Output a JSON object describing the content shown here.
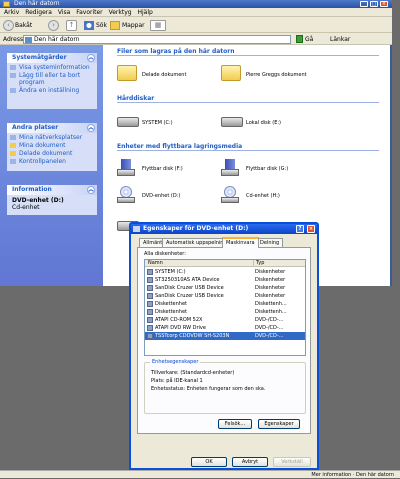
{
  "explorer": {
    "title": "Den här datorn",
    "menu": [
      "Arkiv",
      "Redigera",
      "Visa",
      "Favoriter",
      "Verktyg",
      "Hjälp"
    ],
    "toolbar": {
      "back": "Bakåt",
      "search": "Sök",
      "folders": "Mappar"
    },
    "address_label": "Adress",
    "address_value": "Den här datorn",
    "go_label": "Gå",
    "links_label": "Länkar"
  },
  "tasks": {
    "system": {
      "title": "Systemåtgärder",
      "items": [
        "Visa systeminformation",
        "Lägg till eller ta bort program",
        "Ändra en inställning"
      ]
    },
    "other": {
      "title": "Andra platser",
      "items": [
        "Mina nätverksplatser",
        "Mina dokument",
        "Delade dokument",
        "Kontrollpanelen"
      ]
    },
    "details": {
      "title": "Information",
      "name": "DVD-enhet (D:)",
      "type": "Cd-enhet"
    }
  },
  "main": {
    "section_files": "Filer som lagras på den här datorn",
    "files": [
      "Delade dokument",
      "Pierre Greggs dokument"
    ],
    "section_drives": "Hårddiskar",
    "drives": [
      "SYSTEM (C:)",
      "Lokal disk (E:)"
    ],
    "section_removable": "Enheter med flyttbara lagringsmedia",
    "removable": [
      "Flyttbar disk (F:)",
      "Flyttbar disk (G:)",
      "DVD-enhet (D:)",
      "Cd-enhet (H:)"
    ]
  },
  "status": {
    "text": "Mer information · Den här datorn"
  },
  "dialog": {
    "title": "Egenskaper för DVD-enhet (D:)",
    "tabs": [
      "Allmänt",
      "Automatisk uppspelning",
      "Maskinvara",
      "Delning"
    ],
    "selected_tab": "Maskinvara",
    "list_label": "Alla diskenheter:",
    "columns": [
      "Namn",
      "Typ"
    ],
    "rows": [
      {
        "name": "SYSTEM (C:)",
        "type": "Diskenheter"
      },
      {
        "name": "ST3250310AS ATA Device",
        "type": "Diskenheter"
      },
      {
        "name": "SanDisk Cruzer USB Device",
        "type": "Diskenheter"
      },
      {
        "name": "SanDisk Cruzer USB Device",
        "type": "Diskenheter"
      },
      {
        "name": "Diskettenhet",
        "type": "Diskettenh..."
      },
      {
        "name": "Diskettenhet",
        "type": "Diskettenh..."
      },
      {
        "name": "ATAPI CD-ROM 52X",
        "type": "DVD-/CD-..."
      },
      {
        "name": "ATAPI DVD RW Drive",
        "type": "DVD-/CD-..."
      },
      {
        "name": "TSSTcorp CDDVDW SH-S203N",
        "type": "DVD-/CD-..."
      }
    ],
    "selected_index": 8,
    "props_title": "Enhetsegenskaper",
    "props_lines": [
      "Tillverkare: (Standardcd-enheter)",
      "Plats: på IDE-kanal 1",
      "Enhetsstatus: Enheten fungerar som den ska."
    ],
    "btn_troubleshoot": "Felsök...",
    "btn_properties": "Egenskaper",
    "btn_ok": "OK",
    "btn_cancel": "Avbryt",
    "btn_apply": "Verkställ"
  }
}
